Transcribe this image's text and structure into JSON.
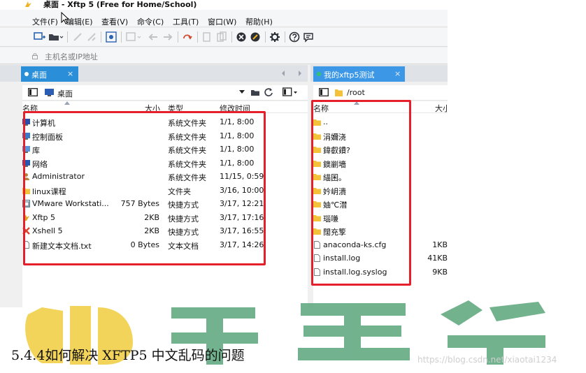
{
  "window": {
    "title": "桌面   - Xftp 5 (Free for Home/School)"
  },
  "menubar": {
    "items": [
      "文件(F)",
      "编辑(E)",
      "查看(V)",
      "命令(C)",
      "工具(T)",
      "窗口(W)",
      "帮助(H)"
    ]
  },
  "addressbar": {
    "placeholder": "主机名或IP地址"
  },
  "left_pane": {
    "tab_label": "桌面",
    "tab_close": "×",
    "path": "桌面",
    "columns": {
      "name": "名称",
      "size": "大小",
      "type": "类型",
      "modified": "修改时间"
    },
    "rows": [
      {
        "name": "计算机",
        "size": "",
        "type": "系统文件夹",
        "modified": "1/1, 8:00",
        "icon": "computer-icon",
        "color": "#2b4fa8"
      },
      {
        "name": "控制面板",
        "size": "",
        "type": "系统文件夹",
        "modified": "1/1, 8:00",
        "icon": "control-panel-icon",
        "color": "#3a7bc8"
      },
      {
        "name": "库",
        "size": "",
        "type": "系统文件夹",
        "modified": "1/1, 8:00",
        "icon": "library-icon",
        "color": "#5b93d6"
      },
      {
        "name": "网络",
        "size": "",
        "type": "系统文件夹",
        "modified": "1/1, 8:00",
        "icon": "network-icon",
        "color": "#2457b0"
      },
      {
        "name": "Administrator",
        "size": "",
        "type": "系统文件夹",
        "modified": "11/15, 0:59",
        "icon": "user-folder-icon",
        "color": "#b5833d"
      },
      {
        "name": "linux课程",
        "size": "",
        "type": "文件夹",
        "modified": "3/16, 10:00",
        "icon": "folder-icon",
        "color": "#f3c23a"
      },
      {
        "name": "VMware Workstati...",
        "size": "757 Bytes",
        "type": "快捷方式",
        "modified": "3/17, 12:21",
        "icon": "vmware-icon",
        "color": "#5f7f8f"
      },
      {
        "name": "Xftp 5",
        "size": "2KB",
        "type": "快捷方式",
        "modified": "3/17, 17:16",
        "icon": "xftp-icon",
        "color": "#e4a11b"
      },
      {
        "name": "Xshell 5",
        "size": "2KB",
        "type": "快捷方式",
        "modified": "3/17, 16:55",
        "icon": "xshell-icon",
        "color": "#d8442f"
      },
      {
        "name": "新建文本文档.txt",
        "size": "0 Bytes",
        "type": "文本文档",
        "modified": "3/17, 14:26",
        "icon": "text-file-icon",
        "color": "#ffffff"
      }
    ]
  },
  "right_pane": {
    "tab_label": "我的xftp5测试",
    "tab_close": "×",
    "path": "/root",
    "columns": {
      "name": "名称",
      "size": "大小"
    },
    "rows": [
      {
        "name": "..",
        "size": "",
        "icon": "folder-icon",
        "color": "#f3c23a"
      },
      {
        "name": "涓嬭浇",
        "size": "",
        "icon": "folder-icon",
        "color": "#f3c23a"
      },
      {
        "name": "鍏叡鐨?",
        "size": "",
        "icon": "folder-icon",
        "color": "#f3c23a"
      },
      {
        "name": "鐭剻墻",
        "size": "",
        "icon": "folder-icon",
        "color": "#f3c23a"
      },
      {
        "name": "緢囷。",
        "size": "",
        "icon": "folder-icon",
        "color": "#f3c23a"
      },
      {
        "name": "妗岄潰",
        "size": "",
        "icon": "folder-icon",
        "color": "#f3c23a"
      },
      {
        "name": "妯℃澘",
        "size": "",
        "icon": "folder-icon",
        "color": "#f3c23a"
      },
      {
        "name": "瑙嗛",
        "size": "",
        "icon": "folder-icon",
        "color": "#f3c23a"
      },
      {
        "name": "闊充箰",
        "size": "",
        "icon": "folder-icon",
        "color": "#f3c23a"
      },
      {
        "name": "anaconda-ks.cfg",
        "size": "1KB",
        "icon": "file-icon",
        "color": "#ffffff"
      },
      {
        "name": "install.log",
        "size": "41KB",
        "icon": "file-icon",
        "color": "#ffffff"
      },
      {
        "name": "install.log.syslog",
        "size": "9KB",
        "icon": "file-icon",
        "color": "#ffffff"
      }
    ]
  },
  "colors": {
    "left_tab": "#2a8fd8",
    "right_tab": "#3c97e6",
    "right_tab_dot": "#34c46b",
    "highlight_border": "#e5202b",
    "watermark_green": "#5aa57a",
    "watermark_yellow": "#f2cd3f"
  },
  "caption": "5.4.4如何解决 XFTP5 中文乱码的问题",
  "watermark_url": "https://blog.csdn.net/xiaotai1234"
}
